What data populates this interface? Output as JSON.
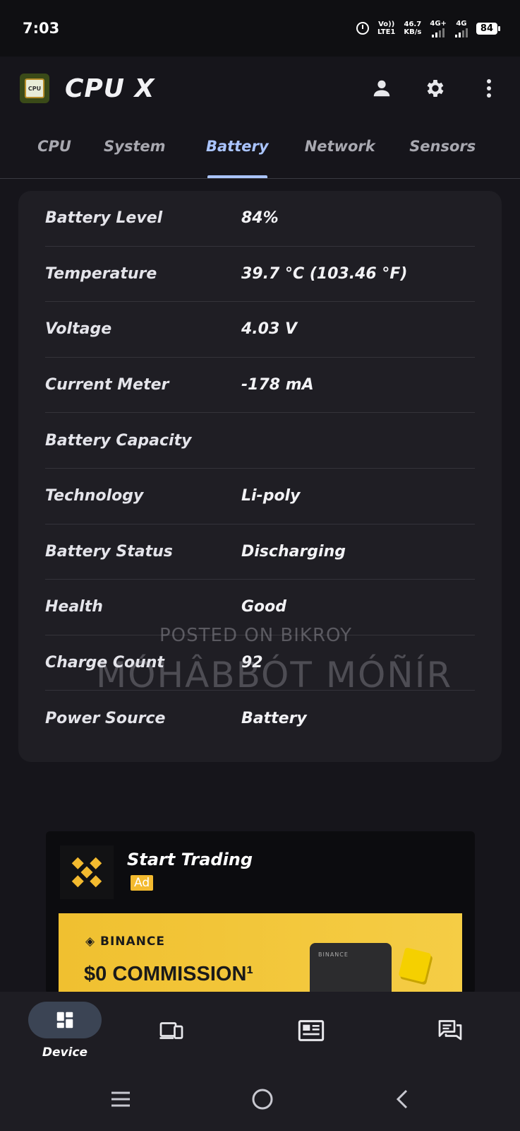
{
  "status_bar": {
    "time": "7:03",
    "volte_top": "Vo))",
    "volte_bottom": "LTE1",
    "speed_value": "46.7",
    "speed_unit": "KB/s",
    "net1": "4G+",
    "net2": "4G",
    "battery": "84"
  },
  "app": {
    "logo_text": "CPU",
    "title": "CPU X"
  },
  "tabs": [
    {
      "label": "CPU",
      "active": false
    },
    {
      "label": "System",
      "active": false
    },
    {
      "label": "Battery",
      "active": true
    },
    {
      "label": "Network",
      "active": false
    },
    {
      "label": "Sensors",
      "active": false
    }
  ],
  "battery": {
    "rows": [
      {
        "label": "Battery Level",
        "value": "84%"
      },
      {
        "label": "Temperature",
        "value": "39.7 °C (103.46 °F)"
      },
      {
        "label": "Voltage",
        "value": "4.03 V"
      },
      {
        "label": "Current Meter",
        "value": "-178 mA"
      },
      {
        "label": "Battery Capacity",
        "value": ""
      },
      {
        "label": "Technology",
        "value": "Li-poly"
      },
      {
        "label": "Battery Status",
        "value": "Discharging"
      },
      {
        "label": "Health",
        "value": "Good"
      },
      {
        "label": "Charge Count",
        "value": "92"
      },
      {
        "label": "Power Source",
        "value": "Battery"
      }
    ]
  },
  "watermark": {
    "line1": "POSTED ON BIKROY",
    "line2": "MÓHÂBBÓT MÓÑÍR"
  },
  "ad": {
    "title": "Start Trading",
    "badge": "Ad",
    "brand": "BINANCE",
    "headline": "$0 COMMISSION¹",
    "card_brand": "BINANCE"
  },
  "bottom_nav": {
    "device_label": "Device"
  },
  "colors": {
    "accent": "#aac4ff",
    "background": "#16151b",
    "card": "#1f1e24",
    "ad_yellow": "#f3ba2f"
  }
}
